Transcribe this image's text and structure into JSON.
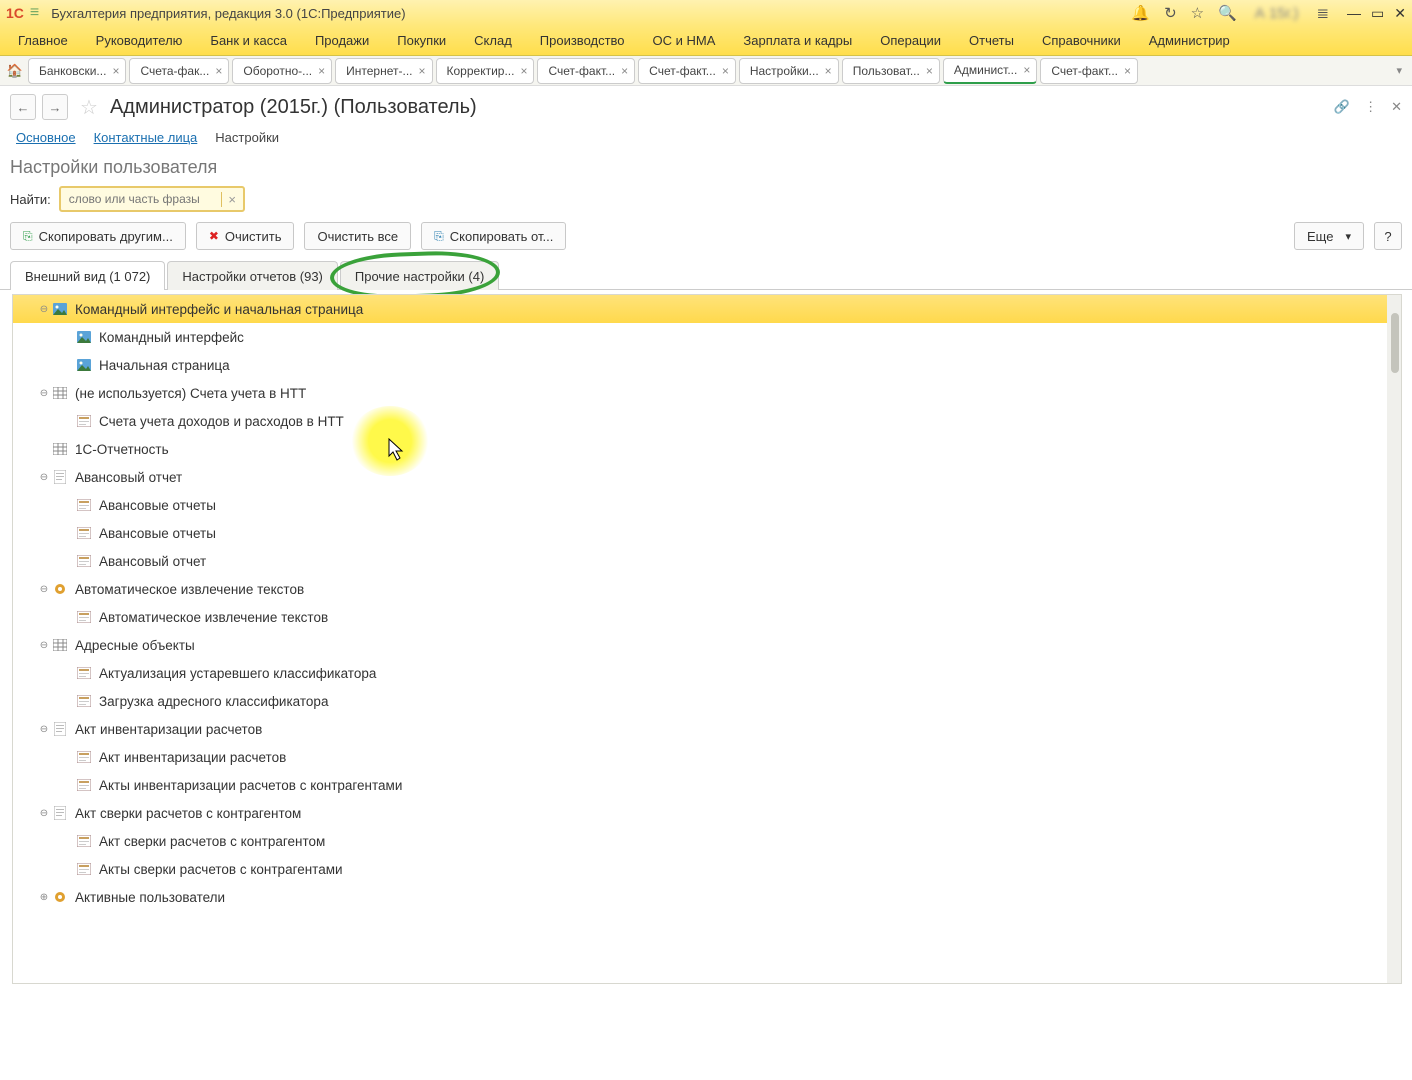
{
  "titlebar": {
    "title": "Бухгалтерия предприятия, редакция 3.0  (1С:Предприятие)",
    "blur": "А    15г.)"
  },
  "mainmenu": [
    "Главное",
    "Руководителю",
    "Банк и касса",
    "Продажи",
    "Покупки",
    "Склад",
    "Производство",
    "ОС и НМА",
    "Зарплата и кадры",
    "Операции",
    "Отчеты",
    "Справочники",
    "Администрир"
  ],
  "apptabs": [
    {
      "label": "Банковски..."
    },
    {
      "label": "Счета-фак..."
    },
    {
      "label": "Оборотно-..."
    },
    {
      "label": "Интернет-..."
    },
    {
      "label": "Корректир..."
    },
    {
      "label": "Счет-факт..."
    },
    {
      "label": "Счет-факт..."
    },
    {
      "label": "Настройки..."
    },
    {
      "label": "Пользоват..."
    },
    {
      "label": "Админист...",
      "active": true
    },
    {
      "label": "Счет-факт..."
    }
  ],
  "page": {
    "title": "Администратор (2015г.) (Пользователь)"
  },
  "subnav": {
    "a": "Основное",
    "b": "Контактные лица",
    "c": "Настройки"
  },
  "section": "Настройки пользователя",
  "find": {
    "label": "Найти:",
    "placeholder": "слово или часть фразы"
  },
  "toolbar": {
    "copyto": "Скопировать другим...",
    "clear": "Очистить",
    "clearall": "Очистить все",
    "copyfrom": "Скопировать от...",
    "more": "Еще",
    "help": "?"
  },
  "settabs": {
    "a": "Внешний вид (1 072)",
    "b": "Настройки отчетов (93)",
    "c": "Прочие настройки (4)"
  },
  "tree": [
    {
      "t": "group",
      "sel": true,
      "exp": "-",
      "icon": "pic",
      "label": "Командный интерфейс и начальная страница"
    },
    {
      "t": "item",
      "icon": "pic",
      "label": "Командный интерфейс"
    },
    {
      "t": "item",
      "icon": "pic",
      "label": "Начальная страница"
    },
    {
      "t": "group",
      "exp": "-",
      "icon": "grid",
      "label": "(не используется) Счета учета в НТТ"
    },
    {
      "t": "item",
      "icon": "form",
      "label": "Счета учета доходов и расходов в НТТ"
    },
    {
      "t": "leafgroup",
      "icon": "grid",
      "label": "1С-Отчетность"
    },
    {
      "t": "group",
      "exp": "-",
      "icon": "doc",
      "label": "Авансовый отчет"
    },
    {
      "t": "item",
      "icon": "form",
      "label": "Авансовые отчеты"
    },
    {
      "t": "item",
      "icon": "form",
      "label": "Авансовые отчеты"
    },
    {
      "t": "item",
      "icon": "form",
      "label": "Авансовый отчет"
    },
    {
      "t": "group",
      "exp": "-",
      "icon": "gear",
      "label": "Автоматическое извлечение текстов"
    },
    {
      "t": "item",
      "icon": "form",
      "label": "Автоматическое извлечение текстов"
    },
    {
      "t": "group",
      "exp": "-",
      "icon": "grid",
      "label": "Адресные объекты"
    },
    {
      "t": "item",
      "icon": "form",
      "label": "Актуализация устаревшего классификатора"
    },
    {
      "t": "item",
      "icon": "form",
      "label": "Загрузка адресного классификатора"
    },
    {
      "t": "group",
      "exp": "-",
      "icon": "doc",
      "label": "Акт инвентаризации расчетов"
    },
    {
      "t": "item",
      "icon": "form",
      "label": "Акт инвентаризации расчетов"
    },
    {
      "t": "item",
      "icon": "form",
      "label": "Акты инвентаризации расчетов с контрагентами"
    },
    {
      "t": "group",
      "exp": "-",
      "icon": "doc",
      "label": "Акт сверки расчетов с контрагентом"
    },
    {
      "t": "item",
      "icon": "form",
      "label": "Акт сверки расчетов с контрагентом"
    },
    {
      "t": "item",
      "icon": "form",
      "label": "Акты сверки расчетов с контрагентами"
    },
    {
      "t": "group",
      "exp": "+",
      "icon": "gear",
      "label": "Активные пользователи"
    }
  ]
}
